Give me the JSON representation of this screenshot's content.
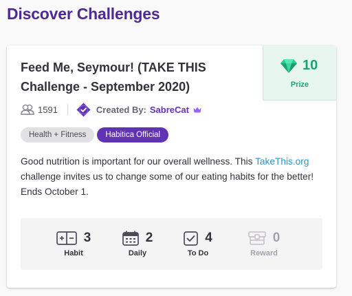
{
  "page": {
    "title": "Discover Challenges"
  },
  "challenge": {
    "title": "Feed Me, Seymour! (TAKE THIS Challenge - September 2020)",
    "prize": {
      "value": "10",
      "label": "Prize",
      "icon": "gem-icon"
    },
    "member_count": "1591",
    "created_by_label": "Created By:",
    "creator": "SabreCat",
    "tags": [
      "Health + Fitness",
      "Habitica Official"
    ],
    "description": {
      "before_link": "Good nutrition is important for our overall wellness. This ",
      "link_text": "TakeThis.org",
      "after_link": " challenge invites us to change some of our eating habits for the better! Ends October 1."
    },
    "tasks": [
      {
        "count": "3",
        "label": "Habit",
        "icon": "habit-icon"
      },
      {
        "count": "2",
        "label": "Daily",
        "icon": "calendar-icon"
      },
      {
        "count": "4",
        "label": "To Do",
        "icon": "checkbox-icon"
      },
      {
        "count": "0",
        "label": "Reward",
        "icon": "reward-icon"
      }
    ]
  },
  "colors": {
    "brand_purple": "#6133b4",
    "title_purple": "#4f2a93",
    "prize_green": "#1ca372",
    "prize_bg": "#e6f6ee",
    "link_blue": "#2995cd"
  }
}
